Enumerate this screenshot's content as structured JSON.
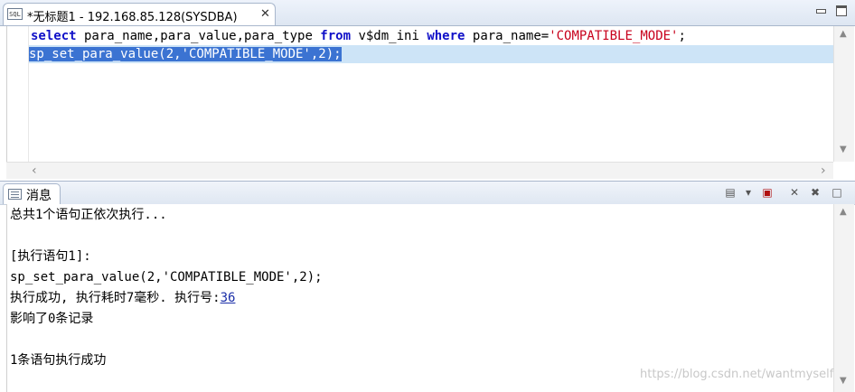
{
  "editor": {
    "tab_icon": "SQL",
    "tab_title": "*无标题1 - 192.168.85.128(SYSDBA)",
    "tab_close": "✕",
    "lines": [
      {
        "parts": [
          {
            "text": "select",
            "kind": "kw"
          },
          {
            "text": " para_name,para_value,para_type ",
            "kind": "plain"
          },
          {
            "text": "from",
            "kind": "kw"
          },
          {
            "text": " v$dm_ini ",
            "kind": "plain"
          },
          {
            "text": "where",
            "kind": "kw"
          },
          {
            "text": " para_name=",
            "kind": "plain"
          },
          {
            "text": "'COMPATIBLE_MODE'",
            "kind": "str"
          },
          {
            "text": ";",
            "kind": "plain"
          }
        ]
      },
      {
        "selected_text": "sp_set_para_value(2,'COMPATIBLE_MODE',2);"
      }
    ]
  },
  "messages_panel": {
    "tab_label": "消息",
    "lines": [
      "总共1个语句正依次执行...",
      "",
      "[执行语句1]:",
      "sp_set_para_value(2,'COMPATIBLE_MODE',2);",
      "执行成功, 执行耗时7毫秒. 执行号:",
      "影响了0条记录",
      "",
      "1条语句执行成功"
    ],
    "exec_number": "36"
  },
  "watermark": "https://blog.csdn.net/wantmyself",
  "colors": {
    "keyword": "#1010c8",
    "string": "#c8001c",
    "selection": "#3b73d2",
    "current_line": "#cde4f7"
  }
}
